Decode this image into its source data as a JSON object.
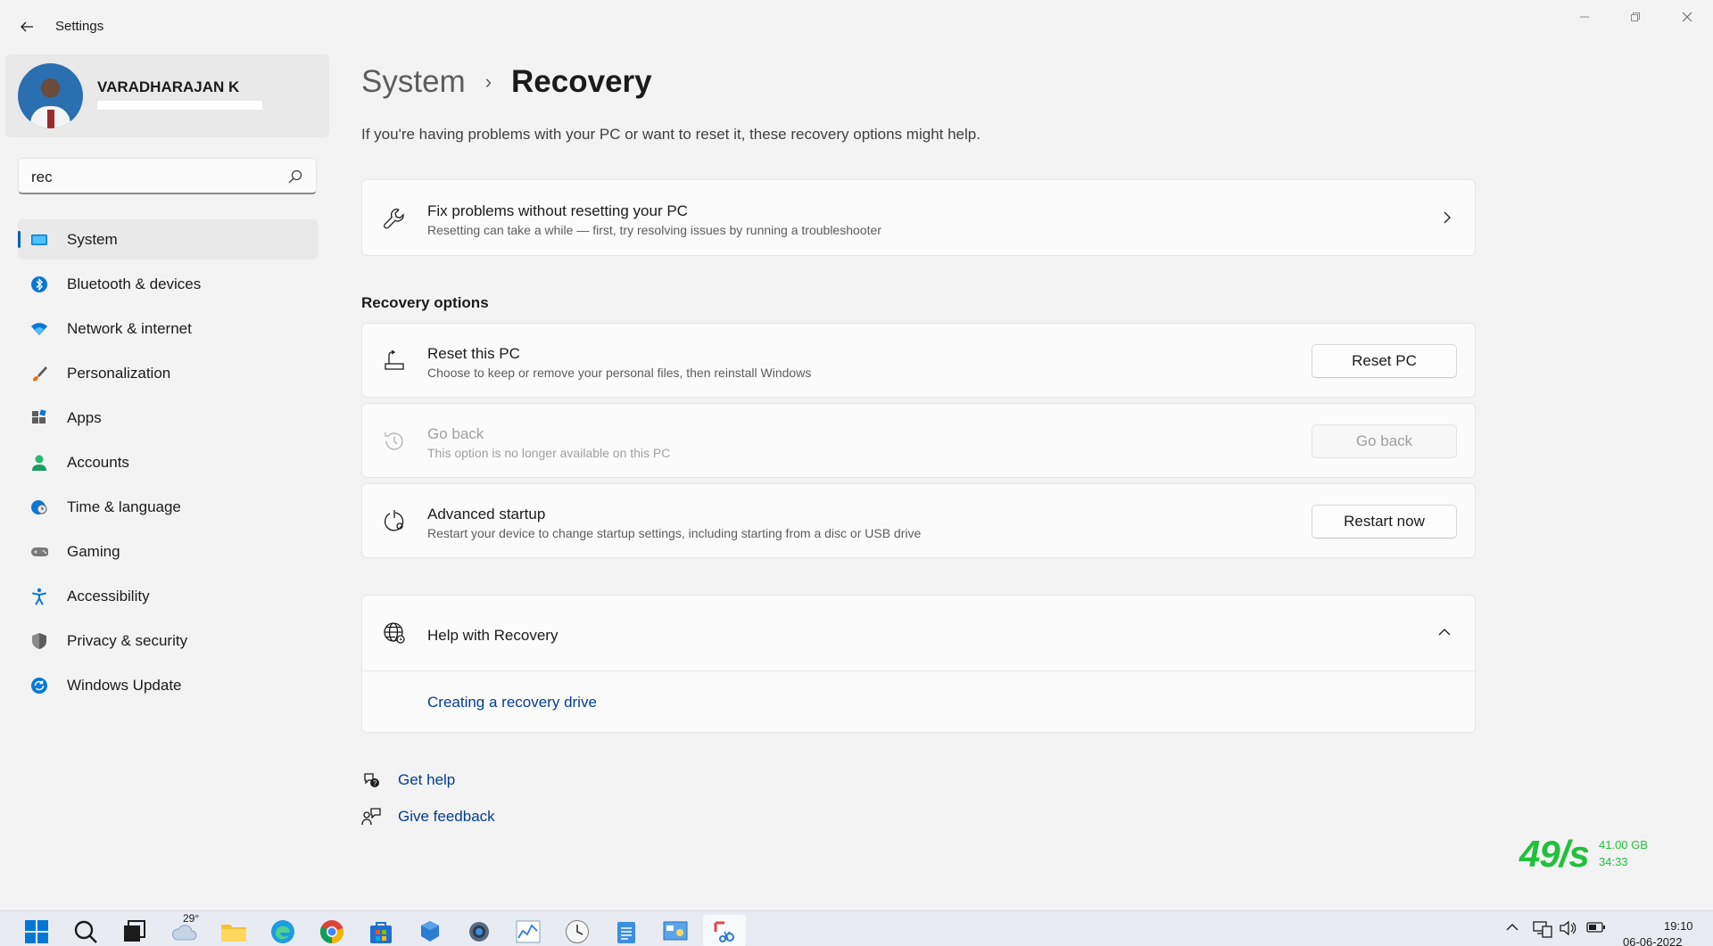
{
  "window": {
    "title": "Settings"
  },
  "profile": {
    "name": "VARADHARAJAN K"
  },
  "search": {
    "value": "rec"
  },
  "nav": {
    "items": [
      {
        "label": "System",
        "icon": "system-icon",
        "active": true
      },
      {
        "label": "Bluetooth & devices",
        "icon": "bluetooth-icon"
      },
      {
        "label": "Network & internet",
        "icon": "wifi-icon"
      },
      {
        "label": "Personalization",
        "icon": "brush-icon"
      },
      {
        "label": "Apps",
        "icon": "apps-icon"
      },
      {
        "label": "Accounts",
        "icon": "person-icon"
      },
      {
        "label": "Time & language",
        "icon": "globe-clock-icon"
      },
      {
        "label": "Gaming",
        "icon": "gamepad-icon"
      },
      {
        "label": "Accessibility",
        "icon": "accessibility-icon"
      },
      {
        "label": "Privacy & security",
        "icon": "shield-icon"
      },
      {
        "label": "Windows Update",
        "icon": "update-icon"
      }
    ]
  },
  "breadcrumb": {
    "parent": "System",
    "separator": "›",
    "current": "Recovery"
  },
  "intro": "If you're having problems with your PC or want to reset it, these recovery options might help.",
  "fix_card": {
    "title": "Fix problems without resetting your PC",
    "subtitle": "Resetting can take a while — first, try resolving issues by running a troubleshooter"
  },
  "recovery_options": {
    "heading": "Recovery options",
    "items": [
      {
        "title": "Reset this PC",
        "subtitle": "Choose to keep or remove your personal files, then reinstall Windows",
        "button": "Reset PC",
        "enabled": true
      },
      {
        "title": "Go back",
        "subtitle": "This option is no longer available on this PC",
        "button": "Go back",
        "enabled": false
      },
      {
        "title": "Advanced startup",
        "subtitle": "Restart your device to change startup settings, including starting from a disc or USB drive",
        "button": "Restart now",
        "enabled": true
      }
    ]
  },
  "help": {
    "title": "Help with Recovery",
    "link": "Creating a recovery drive",
    "expanded": true
  },
  "footer": {
    "get_help": "Get help",
    "give_feedback": "Give feedback"
  },
  "netmeter": {
    "speed": "49/s",
    "total": "41.00 GB",
    "time": "34:33"
  },
  "taskbar": {
    "weather_temp": "29°",
    "clock_time": "19:10",
    "clock_date": "06-06-2022"
  },
  "colors": {
    "accent": "#005fb8",
    "link": "#003e92",
    "background": "#f3f3f3",
    "card": "#fbfbfb",
    "netmeter": "#22c03c"
  }
}
